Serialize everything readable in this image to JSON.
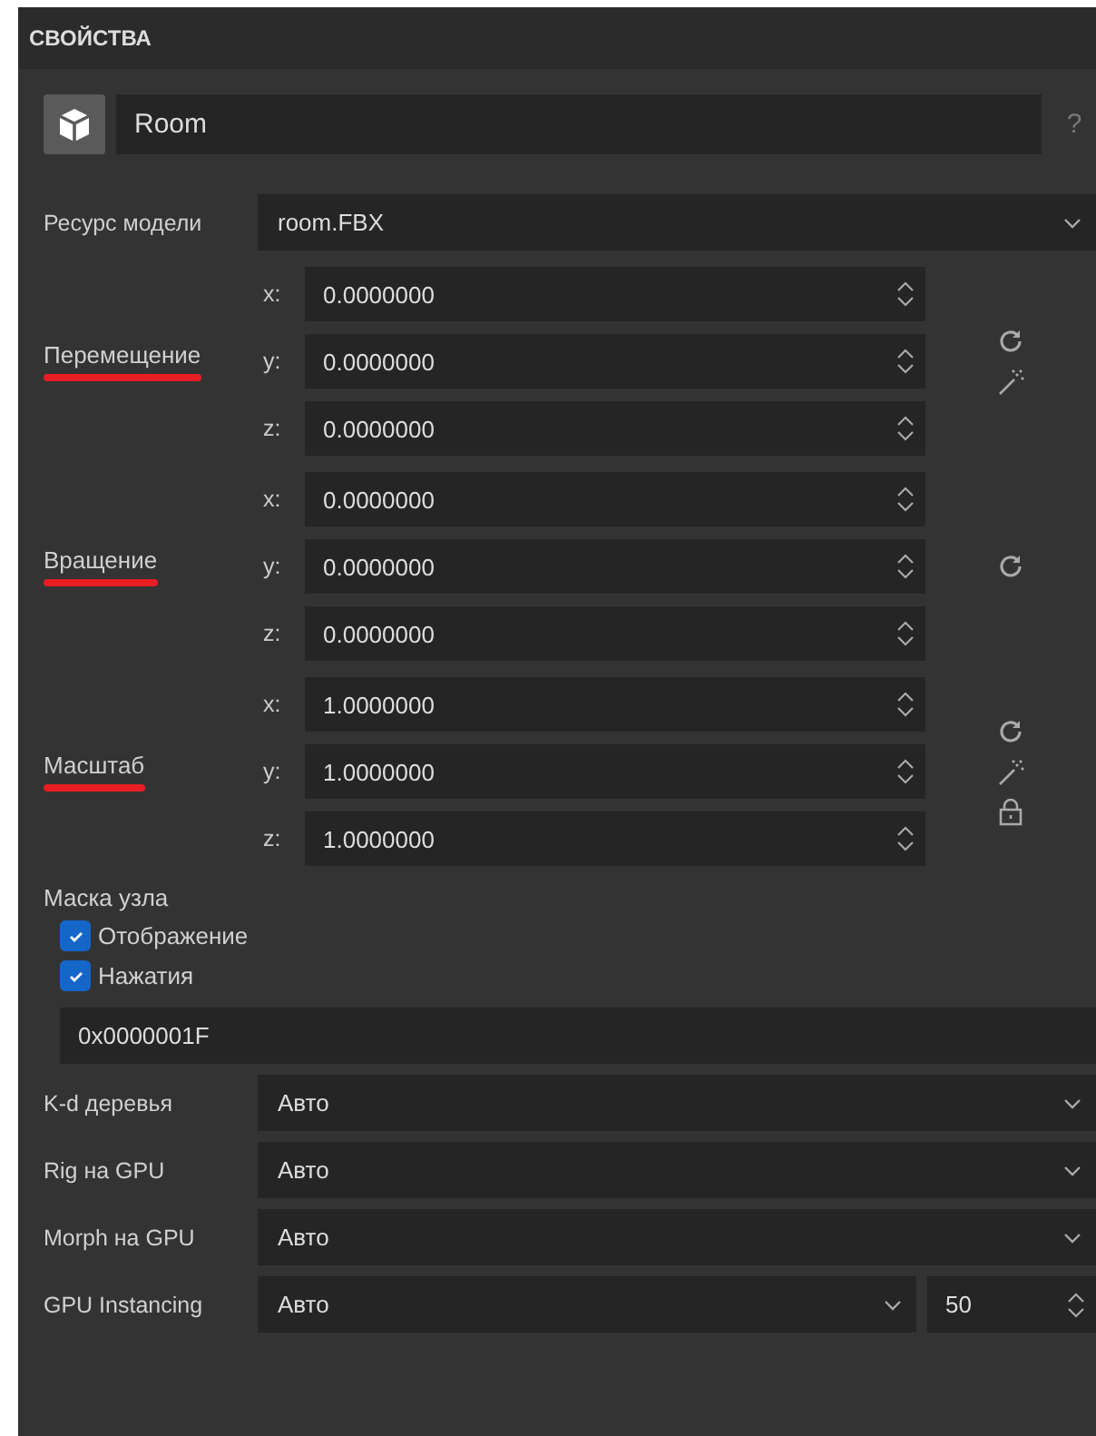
{
  "panel": {
    "title": "СВОЙСТВА"
  },
  "object": {
    "name": "Room",
    "help": "?"
  },
  "model_resource": {
    "label": "Ресурс модели",
    "value": "room.FBX"
  },
  "transforms": [
    {
      "label": "Перемещение",
      "underlined": true,
      "axes": [
        {
          "axis": "x:",
          "value": "0.0000000"
        },
        {
          "axis": "y:",
          "value": "0.0000000"
        },
        {
          "axis": "z:",
          "value": "0.0000000"
        }
      ],
      "actions": [
        {
          "kind": "reset"
        },
        {
          "kind": "wand"
        }
      ]
    },
    {
      "label": "Вращение",
      "underlined": true,
      "axes": [
        {
          "axis": "x:",
          "value": "0.0000000"
        },
        {
          "axis": "y:",
          "value": "0.0000000"
        },
        {
          "axis": "z:",
          "value": "0.0000000"
        }
      ],
      "actions": [
        {
          "kind": "reset"
        }
      ]
    },
    {
      "label": "Масштаб",
      "underlined": true,
      "axes": [
        {
          "axis": "x:",
          "value": "1.0000000"
        },
        {
          "axis": "y:",
          "value": "1.0000000"
        },
        {
          "axis": "z:",
          "value": "1.0000000"
        }
      ],
      "actions": [
        {
          "kind": "reset"
        },
        {
          "kind": "wand"
        },
        {
          "kind": "lock"
        }
      ]
    }
  ],
  "node_mask": {
    "label": "Маска узла",
    "options": [
      {
        "label": "Отображение",
        "checked": true
      },
      {
        "label": "Нажатия",
        "checked": true
      }
    ],
    "value": "0x0000001F"
  },
  "settings": [
    {
      "label": "K-d деревья",
      "value": "Авто"
    },
    {
      "label": "Rig на GPU",
      "value": "Авто"
    },
    {
      "label": "Morph на GPU",
      "value": "Авто"
    },
    {
      "label": "GPU Instancing",
      "value": "Авто",
      "count": "50"
    }
  ]
}
